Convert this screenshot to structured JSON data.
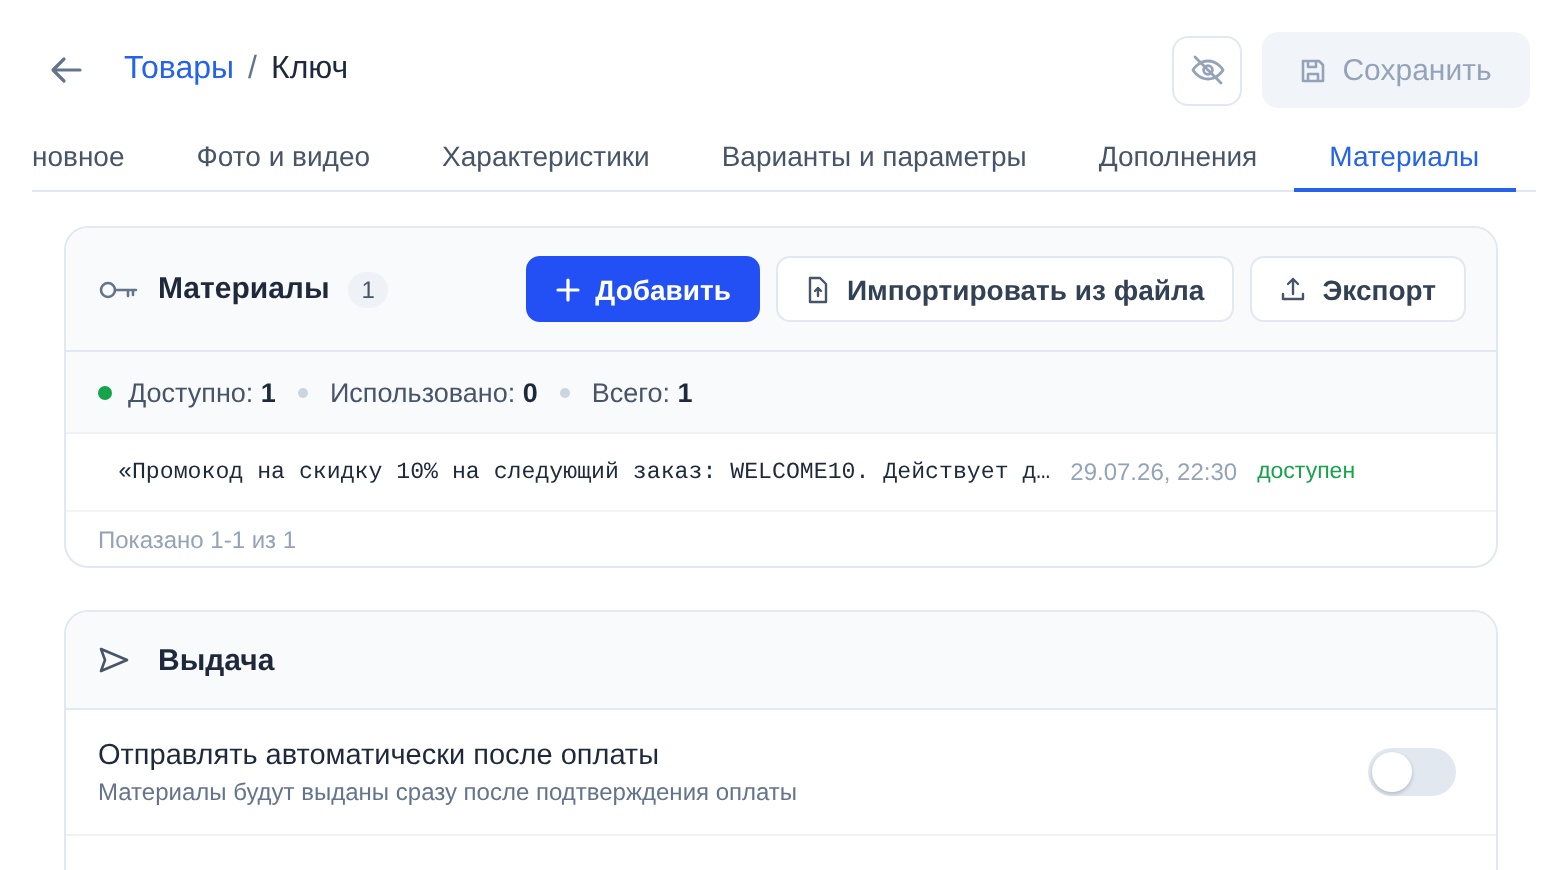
{
  "header": {
    "separator": "/",
    "breadcrumb": [
      {
        "label": "Товары",
        "link": true
      },
      {
        "label": "Ключ",
        "link": false
      }
    ],
    "save": {
      "label": "Сохранить",
      "disabled": true
    }
  },
  "tabs": [
    {
      "label": "новное",
      "selected": false
    },
    {
      "label": "Фото и видео",
      "selected": false
    },
    {
      "label": "Характеристики",
      "selected": false
    },
    {
      "label": "Варианты и параметры",
      "selected": false
    },
    {
      "label": "Дополнения",
      "selected": false
    },
    {
      "label": "Материалы",
      "selected": true
    }
  ],
  "materials": {
    "title": "Материалы",
    "count": "1",
    "buttons": [
      {
        "label": "Добавить",
        "kind": "primary"
      },
      {
        "label": "Импортировать из файла",
        "kind": "import"
      },
      {
        "label": "Экспорт",
        "kind": "export"
      }
    ],
    "stats": [
      {
        "text": "Доступно: **1**",
        "color": "#16a34a"
      },
      {
        "text": "Использовано: **0**"
      },
      {
        "text": "Всего: **1**"
      }
    ],
    "items": [
      {
        "text": "«Промокод на скидку 10% на следующий заказ: WELCOME10. Действует д…",
        "date": "29.07.26, 22:30",
        "status": "доступен"
      }
    ],
    "footer": "Показано 1-1 из 1"
  },
  "delivery": {
    "title": "Выдача",
    "settings": [
      {
        "title": "Отправлять автоматически после оплаты",
        "description": "Материалы будут выданы сразу после подтверждения оплаты",
        "on": false
      }
    ]
  }
}
